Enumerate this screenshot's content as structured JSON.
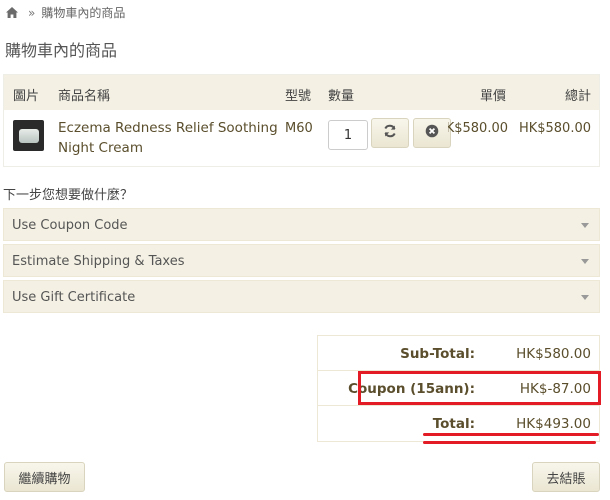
{
  "breadcrumb": {
    "home_icon": "home-icon",
    "separator": "»",
    "current": "購物車內的商品"
  },
  "page_title": "購物車內的商品",
  "cart": {
    "headers": {
      "image": "圖片",
      "name": "商品名稱",
      "model": "型號",
      "quantity": "數量",
      "unit_price": "單價",
      "total": "總計"
    },
    "items": [
      {
        "name": "Eczema Redness Relief Soothing Night Cream",
        "model": "M60",
        "quantity": "1",
        "unit_price": "HK$580.00",
        "total": "HK$580.00"
      }
    ],
    "update_icon": "refresh-icon",
    "remove_icon": "remove-circle-icon"
  },
  "next_step": "下一步您想要做什麼？",
  "panels": [
    "Use Coupon Code",
    "Estimate Shipping & Taxes",
    "Use Gift Certificate"
  ],
  "totals": [
    {
      "label": "Sub-Total:",
      "value": "HK$580.00"
    },
    {
      "label": "Coupon (15ann):",
      "value": "HK$-87.00"
    },
    {
      "label": "Total:",
      "value": "HK$493.00"
    }
  ],
  "buttons": {
    "continue": "繼續購物",
    "checkout": "去結賬"
  },
  "colors": {
    "panel_bg": "#f4f1e4",
    "highlight": "#e21b24",
    "text_link": "#5a4e2c"
  }
}
